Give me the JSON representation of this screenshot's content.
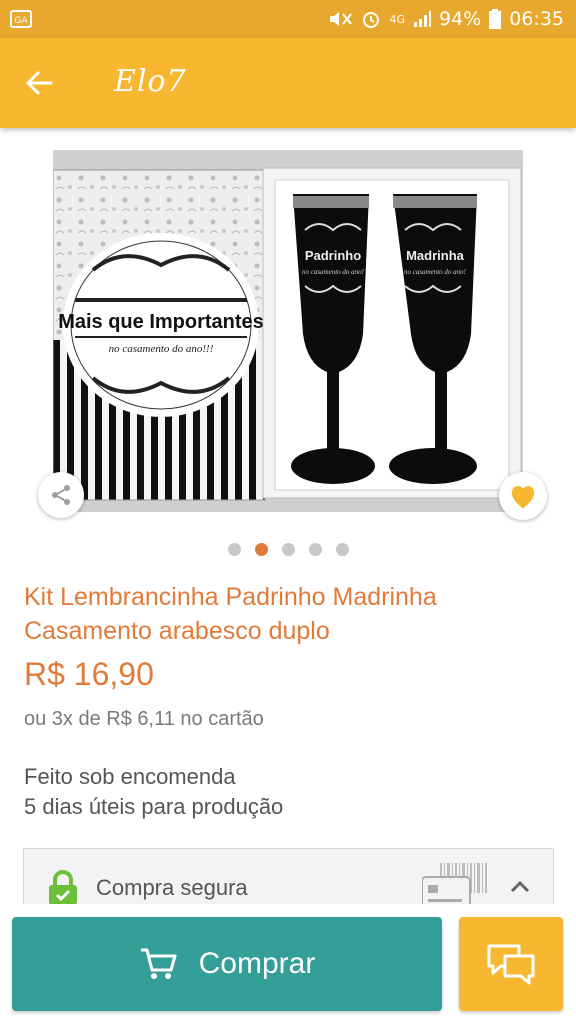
{
  "status_bar": {
    "notification_icon": "gallery-notification-icon",
    "battery_percent": "94%",
    "time": "06:35",
    "network": "4G"
  },
  "app_bar": {
    "title": "Elo7",
    "back_icon": "arrow-left-icon"
  },
  "product_image": {
    "box_text_main": "Mais que Importantes",
    "box_text_sub": "no casamento do ano!!!",
    "glass_left_text": "Padrinho",
    "glass_right_text": "Madrinha",
    "glass_subtext": "no casamento do ano!"
  },
  "carousel": {
    "count": 5,
    "active_index": 1
  },
  "product": {
    "title": "Kit Lembrancinha Padrinho Madrinha Casamento arabesco duplo",
    "price": "R$ 16,90",
    "installments": "ou 3x de R$ 6,11 no cartão",
    "production_line1": "Feito sob encomenda",
    "production_line2": "5 dias úteis para produção"
  },
  "secure": {
    "label": "Compra segura"
  },
  "actions": {
    "buy_label": "Comprar"
  },
  "colors": {
    "status_bar": "#e8a82e",
    "app_bar": "#f7b731",
    "accent_orange": "#e07b39",
    "buy_button": "#349e98",
    "secure_green": "#6cbf3a"
  }
}
